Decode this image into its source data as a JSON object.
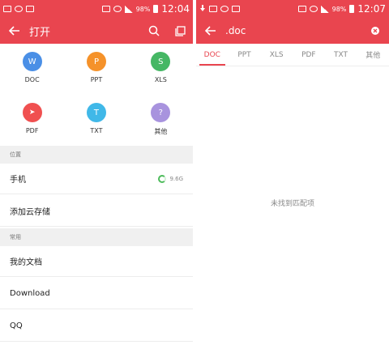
{
  "left": {
    "status": {
      "battery": "98%",
      "time": "12:04"
    },
    "appbar": {
      "title": "打开"
    },
    "file_types": [
      {
        "letter": "W",
        "label": "DOC",
        "color": "#4a8fe6"
      },
      {
        "letter": "P",
        "label": "PPT",
        "color": "#f5922a"
      },
      {
        "letter": "S",
        "label": "XLS",
        "color": "#45b764"
      },
      {
        "letter": "➤",
        "label": "PDF",
        "color": "#f05050"
      },
      {
        "letter": "T",
        "label": "TXT",
        "color": "#40b8e8"
      },
      {
        "letter": "?",
        "label": "其他",
        "color": "#a893de"
      }
    ],
    "section_location": "位置",
    "phone": {
      "label": "手机",
      "storage": "9.6G"
    },
    "add_cloud": "添加云存储",
    "section_common": "常用",
    "common": [
      "我的文档",
      "Download",
      "QQ"
    ]
  },
  "right": {
    "status": {
      "battery": "98%",
      "time": "12:07"
    },
    "search": {
      "query": ".doc"
    },
    "tabs": [
      "DOC",
      "PPT",
      "XLS",
      "PDF",
      "TXT",
      "其他"
    ],
    "empty_message": "未找到匹配项"
  },
  "colors": {
    "accent": "#e9454f"
  },
  "icons": [
    "back-arrow-icon",
    "search-icon",
    "window-icon",
    "clear-icon"
  ]
}
